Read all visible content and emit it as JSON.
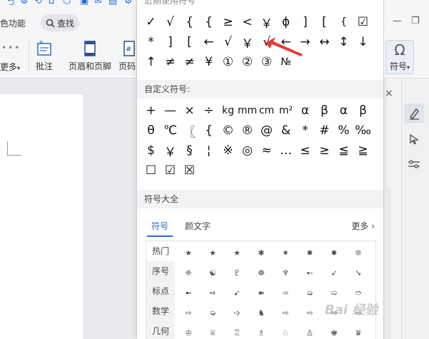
{
  "ribbon": {
    "tab_fragment": "色功能",
    "search_label": "查找",
    "more_label": "更多",
    "buttons": [
      {
        "label": "批注"
      },
      {
        "label": "页眉和页脚"
      },
      {
        "label": "页码"
      }
    ]
  },
  "panel": {
    "recent_header_fragment": "近期使用符号",
    "recent_symbols": [
      "✓",
      "√",
      "{",
      "{",
      "≥",
      "<",
      "￥",
      "ϕ",
      "]",
      "[",
      "{",
      "☑",
      "*",
      "]",
      "[",
      "←",
      "√",
      "￥",
      "√",
      "←",
      "→",
      "↔",
      "↕",
      "↓",
      "↑",
      "≠",
      "≠",
      "¥",
      "①",
      "②",
      "③",
      "№"
    ],
    "custom_header": "自定义符号:",
    "custom_symbols": [
      "+",
      "—",
      "×",
      "÷",
      "kg",
      "mm",
      "cm",
      "m²",
      "α",
      "β",
      "α",
      "β",
      "θ",
      "℃",
      "〖",
      "{",
      "©",
      "®",
      "@",
      "&",
      "*",
      "#",
      "%",
      "‰",
      "$",
      "￥",
      "§",
      "¦",
      "※",
      "◎",
      "≈",
      "…",
      "≤",
      "≥",
      "≦",
      "≧",
      "☐",
      "☑",
      "☒"
    ],
    "all_header": "符号大全",
    "tabs": [
      {
        "label": "符号"
      },
      {
        "label": "颜文字"
      }
    ],
    "more_link": "更多",
    "categories": [
      "热门",
      "序号",
      "标点",
      "数学",
      "几何"
    ],
    "symbol_rows": [
      [
        "★",
        "★",
        "★",
        "✱",
        "✷",
        "✸",
        "✹",
        "❊"
      ],
      [
        "❈",
        "☯",
        "♇",
        "☸",
        "♆",
        "➸",
        "➶",
        "➘"
      ],
      [
        "➼",
        "➺",
        "➹",
        "➽",
        "➾",
        "➭",
        "➯",
        "➱"
      ],
      [
        "⇨",
        "➭",
        "➩",
        "♞",
        "⇨",
        "⇨",
        "⇨",
        "⇨"
      ],
      [
        "♔",
        "♕",
        "♖",
        "♗",
        "♘",
        "♙",
        "♚",
        "♛"
      ]
    ]
  },
  "right": {
    "minimize": "—",
    "restore": "❐",
    "symbol_label": "符号",
    "close_sidebar": "×"
  },
  "watermark": "Bai 经验",
  "colors": {
    "accent": "#2a6ad6",
    "arrow_red": "#e23b3b"
  }
}
